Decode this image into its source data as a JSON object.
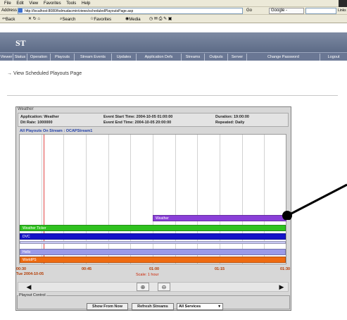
{
  "browser": {
    "menu": [
      "File",
      "Edit",
      "View",
      "Favorites",
      "Tools",
      "Help"
    ],
    "address_label": "Address",
    "url": "http://localhost:8080/fsdmudacmin/views/scheduledPlayoutsPage.asp",
    "go_label": "Go",
    "google_label": "Google -",
    "links_label": "Links",
    "toolbar": {
      "back": "Back",
      "search": "Search",
      "favorites": "Favorites",
      "media": "Media"
    }
  },
  "header": {
    "logo": "ST",
    "nav": [
      "Viewer",
      "Status",
      "Operation",
      "Playouts",
      "Stream Events",
      "Updates",
      "Application Defs",
      "Streams",
      "Outputs",
      "Server",
      "Change Password",
      "Logout"
    ]
  },
  "breadcrumb": "View Scheduled Playouts Page",
  "application": {
    "panel_title": "Weather",
    "application_label": "Application: Weather",
    "dit_label": "Dit Rate: 1000000",
    "start_time": "Event Start Time: 2004-10-05 01:00:00",
    "end_time": "Event End Time: 2004-10-05 20:00:00",
    "duration": "Duration: 19:00:00",
    "repeated": "Repeated: Daily",
    "stream_label": "All Playouts On Stream : OCAPStream1"
  },
  "timeline": {
    "bars": [
      {
        "label": "Weather",
        "color": "#8a3fd8"
      },
      {
        "label": "Weather Ticker",
        "color": "#2fc11f"
      },
      {
        "label": "DVC",
        "color": "#1414c8"
      },
      {
        "label": "",
        "color": "#c8c8f2"
      },
      {
        "label": "Hello",
        "color": "#9a9ae8"
      },
      {
        "label": "WorldPS",
        "color": "#ee6a10"
      }
    ],
    "ticks": [
      "00:30",
      "00:45",
      "01:00",
      "01:15",
      "01:30"
    ],
    "date": "Tue 2004-10-05",
    "scale": "Scale: 1 hour"
  },
  "controls": {
    "left_arrow": "◀",
    "right_arrow": "▶",
    "zoom_in": "🔍+",
    "zoom_out": "🔍-",
    "legend": "Playout Control",
    "show_from_now": "Show From Now",
    "refresh_streams": "Refresh Streams",
    "all_services": "All Services"
  },
  "colors": {
    "banner": "#6a7794",
    "marker": "#000000"
  }
}
